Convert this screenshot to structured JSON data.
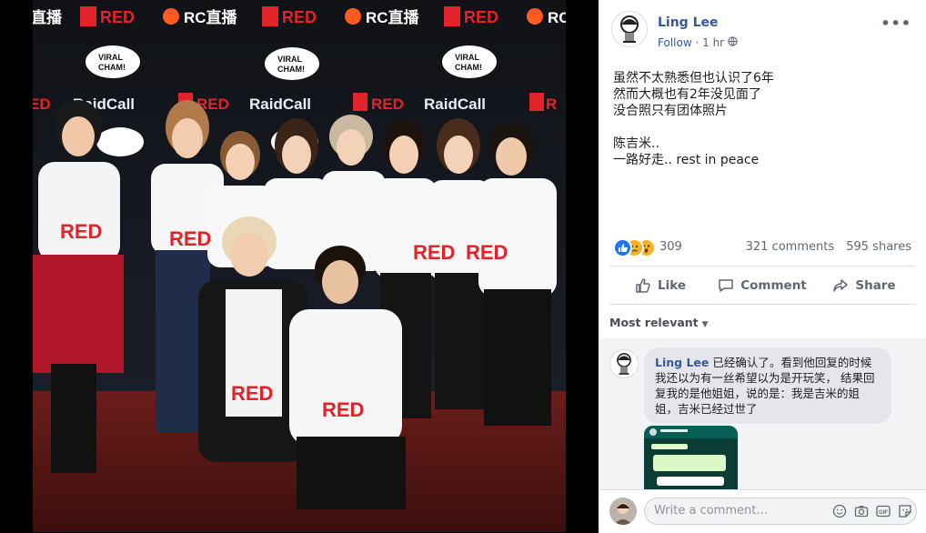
{
  "post": {
    "author": "Ling Lee",
    "follow_label": "Follow",
    "separator": "·",
    "time": "1 hr",
    "more": "•••",
    "body_lines": [
      "虽然不太熟悉但也认识了6年",
      "然而大概也有2年没见面了",
      "没合照只有团体照片",
      "陈吉米..",
      "一路好走.. rest in peace"
    ],
    "reaction_count": "309",
    "comments_count": "321 comments",
    "shares_count": "595 shares",
    "reaction_types": [
      "like-icon",
      "sad-icon",
      "wow-icon"
    ],
    "reaction_colors": {
      "like": "#1877f2",
      "sad": "#f7b125",
      "wow": "#f7b125"
    }
  },
  "actions": {
    "like": "Like",
    "comment": "Comment",
    "share": "Share"
  },
  "comments": {
    "sort_label": "Most relevant",
    "items": [
      {
        "name": "Ling Lee",
        "text": "已经确认了。看到他回复的时候我还以为有一丝希望以为是开玩笑， 结果回复我的是他姐姐，说的是：我是吉米的姐姐，吉米已经过世了"
      }
    ]
  },
  "composer": {
    "placeholder": "Write a comment..."
  },
  "photo": {
    "backdrop_logos": [
      "RED",
      "RC直播",
      "RaidCall",
      "VIRAL CHAM!"
    ],
    "shirt_text": "RED"
  }
}
